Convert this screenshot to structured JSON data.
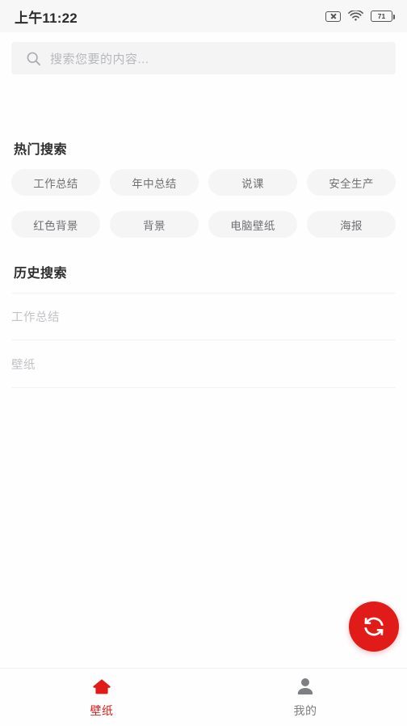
{
  "statusbar": {
    "time": "上午11:22",
    "battery_level": "71",
    "icons": [
      "no-signal-icon",
      "wifi-icon",
      "battery-icon"
    ]
  },
  "search": {
    "placeholder": "搜索您要的内容...",
    "value": "",
    "icon": "search-icon"
  },
  "hot": {
    "title": "热门搜索",
    "rows": [
      [
        "工作总结",
        "年中总结",
        "说课",
        "安全生产"
      ],
      [
        "红色背景",
        "背景",
        "电脑壁纸",
        "海报"
      ]
    ]
  },
  "history": {
    "title": "历史搜索",
    "items": [
      "工作总结",
      "壁纸"
    ]
  },
  "fab": {
    "icon": "refresh-icon",
    "color": "#e01b18"
  },
  "tabbar": {
    "items": [
      {
        "label": "壁纸",
        "icon": "home-icon",
        "active": true
      },
      {
        "label": "我的",
        "icon": "person-icon",
        "active": false
      }
    ]
  },
  "colors": {
    "accent": "#e01b18",
    "page_bg": "#fefefe",
    "chip_bg": "#f5f5f6",
    "search_bg": "#f4f4f5",
    "status_bg": "#f7f7f7"
  }
}
